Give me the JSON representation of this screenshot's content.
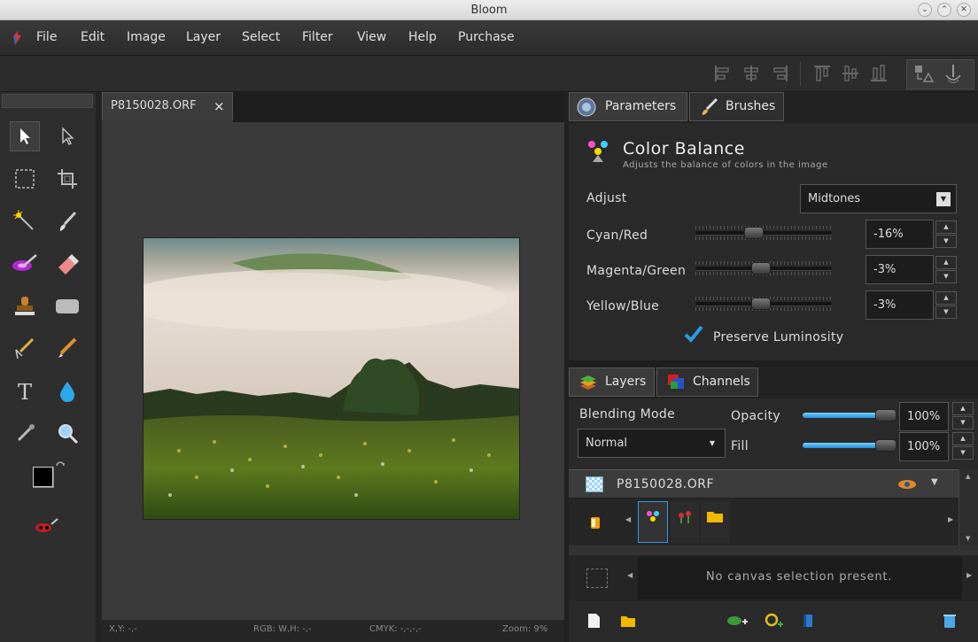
{
  "window": {
    "title": "Bloom"
  },
  "menu": [
    "File",
    "Edit",
    "Image",
    "Layer",
    "Select",
    "Filter",
    "View",
    "Help",
    "Purchase"
  ],
  "document_tab": {
    "name": "P8150028.ORF",
    "close": "×"
  },
  "status": {
    "xy": "X,Y: -,-",
    "rgb": "RGB: W,H: -,-",
    "cmyk": "CMYK: -,-,-,-",
    "zoom": "Zoom: 9%"
  },
  "panel_tabs": {
    "parameters": "Parameters",
    "brushes": "Brushes"
  },
  "color_balance": {
    "title": "Color Balance",
    "subtitle": "Adjusts the balance of colors in the image",
    "adjust_label": "Adjust",
    "adjust_value": "Midtones",
    "sliders": [
      {
        "label": "Cyan/Red",
        "value": "-16%",
        "fraction": 0.42
      },
      {
        "label": "Magenta/Green",
        "value": "-3%",
        "fraction": 0.48
      },
      {
        "label": "Yellow/Blue",
        "value": "-3%",
        "fraction": 0.48
      }
    ],
    "preserve_luminosity": "Preserve Luminosity",
    "preserve_checked": true
  },
  "layers_tabs": {
    "layers": "Layers",
    "channels": "Channels"
  },
  "layers": {
    "blending_label": "Blending Mode",
    "blending_value": "Normal",
    "opacity_label": "Opacity",
    "opacity_value": "100%",
    "fill_label": "Fill",
    "fill_value": "100%",
    "layer_name": "P8150028.ORF",
    "selection_text": "No canvas selection present."
  },
  "colors": {
    "accent": "#2a9ae6",
    "swatch_fg": "#000000",
    "swatch_bg": "#ffffff"
  }
}
